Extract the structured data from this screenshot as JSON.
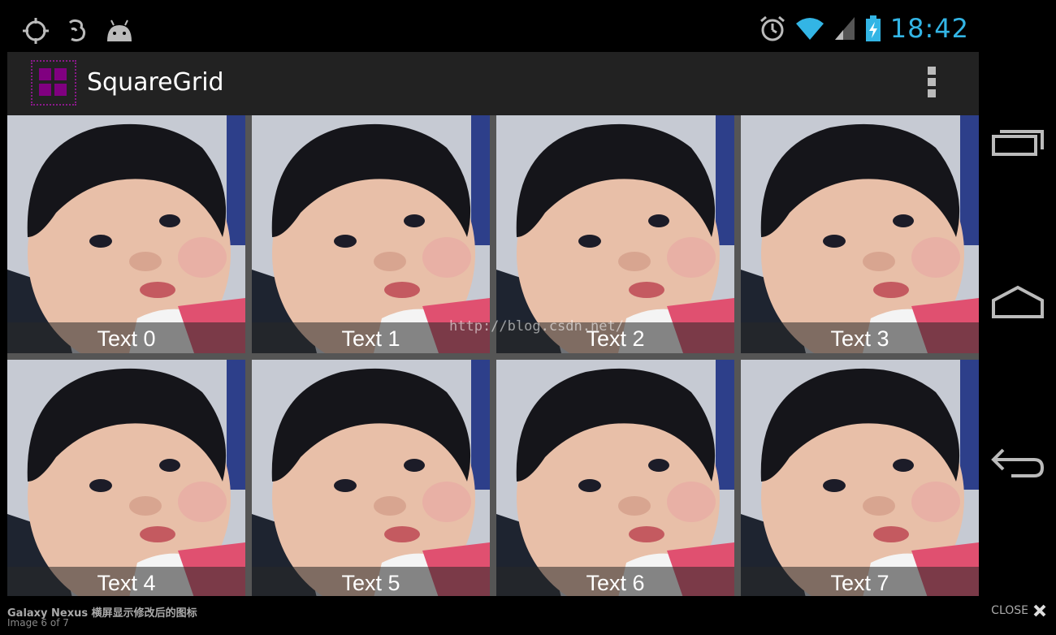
{
  "status_bar": {
    "left_icons": [
      "gps-icon",
      "notification-icon",
      "android-icon"
    ],
    "right_icons": [
      "alarm-icon",
      "wifi-icon",
      "signal-icon",
      "battery-charging-icon"
    ],
    "time": "18:42",
    "accent_color": "#33b5e5"
  },
  "action_bar": {
    "title": "SquareGrid",
    "app_icon": "grid-app-icon",
    "menu_icon": "overflow-menu-icon"
  },
  "grid": {
    "items": [
      {
        "label": "Text 0"
      },
      {
        "label": "Text 1"
      },
      {
        "label": "Text 2"
      },
      {
        "label": "Text 3"
      },
      {
        "label": "Text 4"
      },
      {
        "label": "Text 5"
      },
      {
        "label": "Text 6"
      },
      {
        "label": "Text 7"
      }
    ],
    "watermark": "http://blog.csdn.net/"
  },
  "nav_bar": {
    "buttons": [
      "recent-apps-icon",
      "home-icon",
      "back-icon"
    ]
  },
  "footer": {
    "title": "Galaxy Nexus 横屏显示修改后的图标",
    "count": "Image 6 of 7",
    "close_label": "CLOSE"
  }
}
